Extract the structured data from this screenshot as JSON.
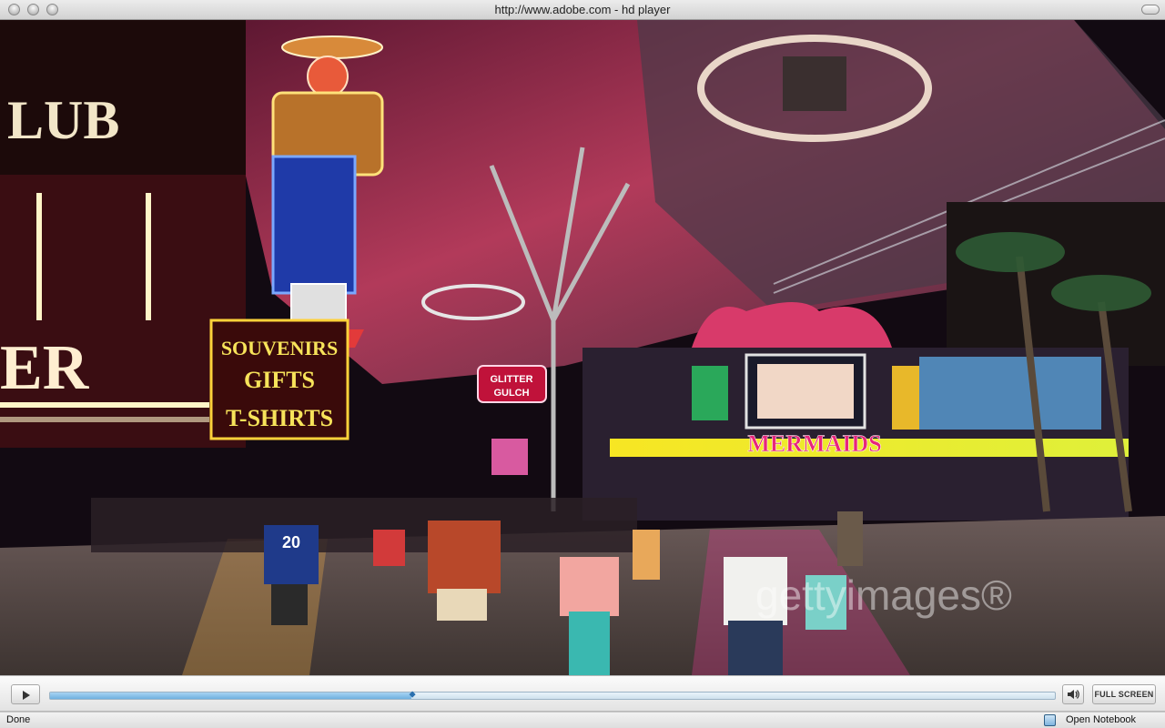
{
  "window": {
    "title": "http://www.adobe.com - hd player"
  },
  "video": {
    "description_icon": "video-frame",
    "signs": {
      "souvenirs": [
        "SOUVENIRS",
        "GIFTS",
        "T-SHIRTS"
      ],
      "mermaids": "MERMAIDS",
      "glitter": [
        "GLITTER",
        "GULCH"
      ],
      "club": [
        "LUB",
        "ER"
      ]
    },
    "jersey_number": "20",
    "watermark": "gettyimages®"
  },
  "controls": {
    "play_icon": "play-icon",
    "volume_icon": "speaker-icon",
    "fullscreen_label": "FULL SCREEN",
    "progress_fraction": 0.36
  },
  "status": {
    "text": "Done",
    "notebook_label": "Open Notebook",
    "notebook_icon": "notebook-icon"
  },
  "colors": {
    "progress_fill": "#6fb1e0",
    "titlebar": "#d2d2d2"
  }
}
